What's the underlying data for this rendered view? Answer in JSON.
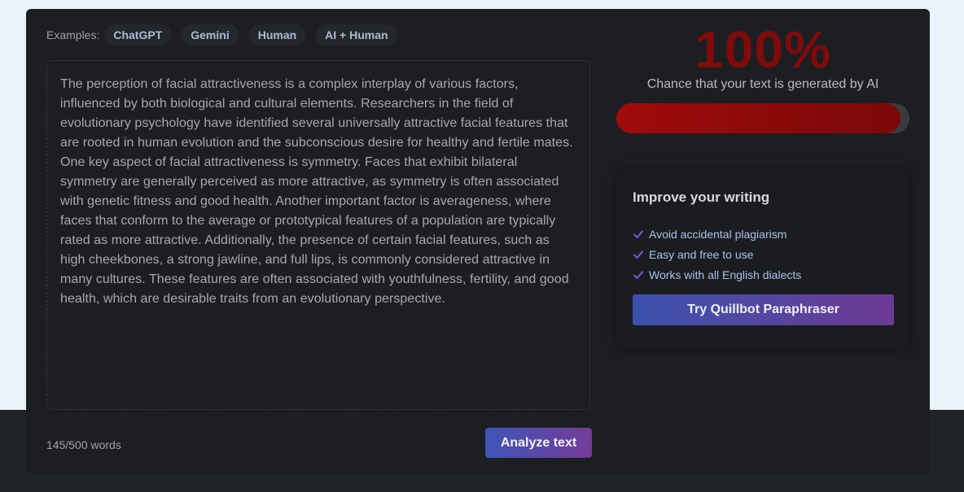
{
  "examples": {
    "label": "Examples:",
    "chips": [
      "ChatGPT",
      "Gemini",
      "Human",
      "AI + Human"
    ]
  },
  "input": {
    "text": "The perception of facial attractiveness is a complex interplay of various factors, influenced by both biological and cultural elements. Researchers in the field of evolutionary psychology have identified several universally attractive facial features that are rooted in human evolution and the subconscious desire for healthy and fertile mates. One key aspect of facial attractiveness is symmetry. Faces that exhibit bilateral symmetry are generally perceived as more attractive, as symmetry is often associated with genetic fitness and good health. Another important factor is averageness, where faces that conform to the average or prototypical features of a population are typically rated as more attractive. Additionally, the presence of certain facial features, such as high cheekbones, a strong jawline, and full lips, is commonly considered attractive in many cultures. These features are often associated with youthfulness, fertility, and good health, which are desirable traits from an evolutionary perspective.",
    "word_count": "145/500 words",
    "analyze_label": "Analyze text"
  },
  "result": {
    "score": "100%",
    "score_value": 100,
    "caption": "Chance that your text is generated by AI",
    "meter_fill_percent": 97
  },
  "improve": {
    "title": "Improve your writing",
    "benefits": [
      "Avoid accidental plagiarism",
      "Easy and free to use",
      "Works with all English dialects"
    ],
    "cta_label": "Try Quillbot Paraphraser"
  },
  "colors": {
    "score_red": "#7f0b0b",
    "check_purple": "#6c5bc7",
    "accent_gradient_start": "#3f55b8",
    "accent_gradient_end": "#743c97"
  }
}
